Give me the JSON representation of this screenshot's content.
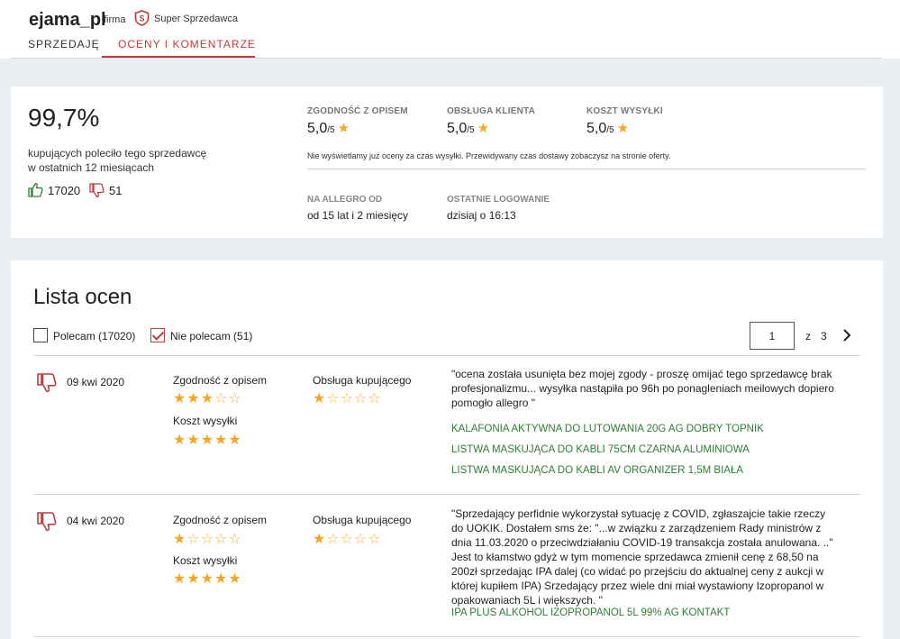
{
  "seller": {
    "name": "ejama_pl",
    "type": "firma",
    "badge": "Super Sprzedawca"
  },
  "tabs": [
    {
      "label": "SPRZEDAJĘ",
      "active": false
    },
    {
      "label": "OCENY I KOMENTARZE",
      "active": true
    }
  ],
  "summary": {
    "percent": "99,7%",
    "percent_desc_line1": "kupujących poleciło tego sprzedawcę",
    "percent_desc_line2": "w ostatnich 12 miesiącach",
    "positive_count": "17020",
    "negative_count": "51",
    "metrics": [
      {
        "label": "ZGODNOŚĆ Z OPISEM",
        "value": "5,0",
        "of": "/5"
      },
      {
        "label": "OBSŁUGA KLIENTA",
        "value": "5,0",
        "of": "/5"
      },
      {
        "label": "KOSZT WYSYŁKI",
        "value": "5,0",
        "of": "/5"
      }
    ],
    "note": "Nie wyświetlamy już oceny za czas wysyłki.  Przewidywany czas dostawy zobaczysz na stronie oferty.",
    "on_allegro_label": "NA ALLEGRO OD",
    "on_allegro_value": "od 15 lat i 2 miesięcy",
    "last_login_label": "OSTATNIE LOGOWANIE",
    "last_login_value": "dzisiaj o 16:13"
  },
  "list": {
    "title": "Lista ocen",
    "filters": [
      {
        "label": "Polecam (17020)",
        "checked": false
      },
      {
        "label": "Nie polecam (51)",
        "checked": true
      }
    ],
    "pagination": {
      "current": "1",
      "of_label": "z",
      "total": "3"
    }
  },
  "reviews": [
    {
      "type": "negative",
      "date": "09 kwi 2020",
      "desc_label": "Zgodność z opisem",
      "desc_stars": 3,
      "shipping_label": "Koszt wysyłki",
      "shipping_stars": 5,
      "service_label": "Obsługa kupującego",
      "service_stars": 1,
      "comment": "\"ocena została usunięta bez mojej zgody - proszę omijać tego sprzedawcę brak profesjonalizmu... wysyłka nastąpiła po 96h po ponagleniach meilowych dopiero pomogło allegro \"",
      "products": [
        "KALAFONIA AKTYWNA DO LUTOWANIA 20g AG DOBRY TOPNIK",
        "LISTWA MASKUJĄCA DO KABLI 75cm CZARNA ALUMINIOWA",
        "LISTWA MASKUJĄCA DO KABLI AV ORGANIZER 1,5m BIAŁA"
      ]
    },
    {
      "type": "negative",
      "date": "04 kwi 2020",
      "desc_label": "Zgodność z opisem",
      "desc_stars": 1,
      "shipping_label": "Koszt wysyłki",
      "shipping_stars": 5,
      "service_label": "Obsługa kupującego",
      "service_stars": 1,
      "comment": "\"Sprzedający perfidnie wykorzystał sytuację z COVID, zgłaszajcie takie rzeczy do UOKIK. Dostałem sms że: \"...w związku z zarządzeniem Rady ministrów z dnia 11.03.2020 o przeciwdziałaniu COVID-19 transakcja została anulowana. ..\" Jest to kłamstwo gdyż w tym momencie sprzedawca zmienił cenę z 68,50 na 200zł sprzedając IPA dalej (co widać po przejściu do aktualnej ceny z aukcji w której kupiłem IPA) Srzedający przez wiele dni miał wystawiony Izopropanol w opakowaniach 5L i większych. \"",
      "products": [
        "IPA PLUS ALKOHOL IZOPROPANOL 5L 99% AG KONTAKT"
      ]
    }
  ],
  "colors": {
    "accent": "#c23a3a",
    "star": "#f5a623",
    "positive": "#2e7d32",
    "background": "#eceff1"
  }
}
